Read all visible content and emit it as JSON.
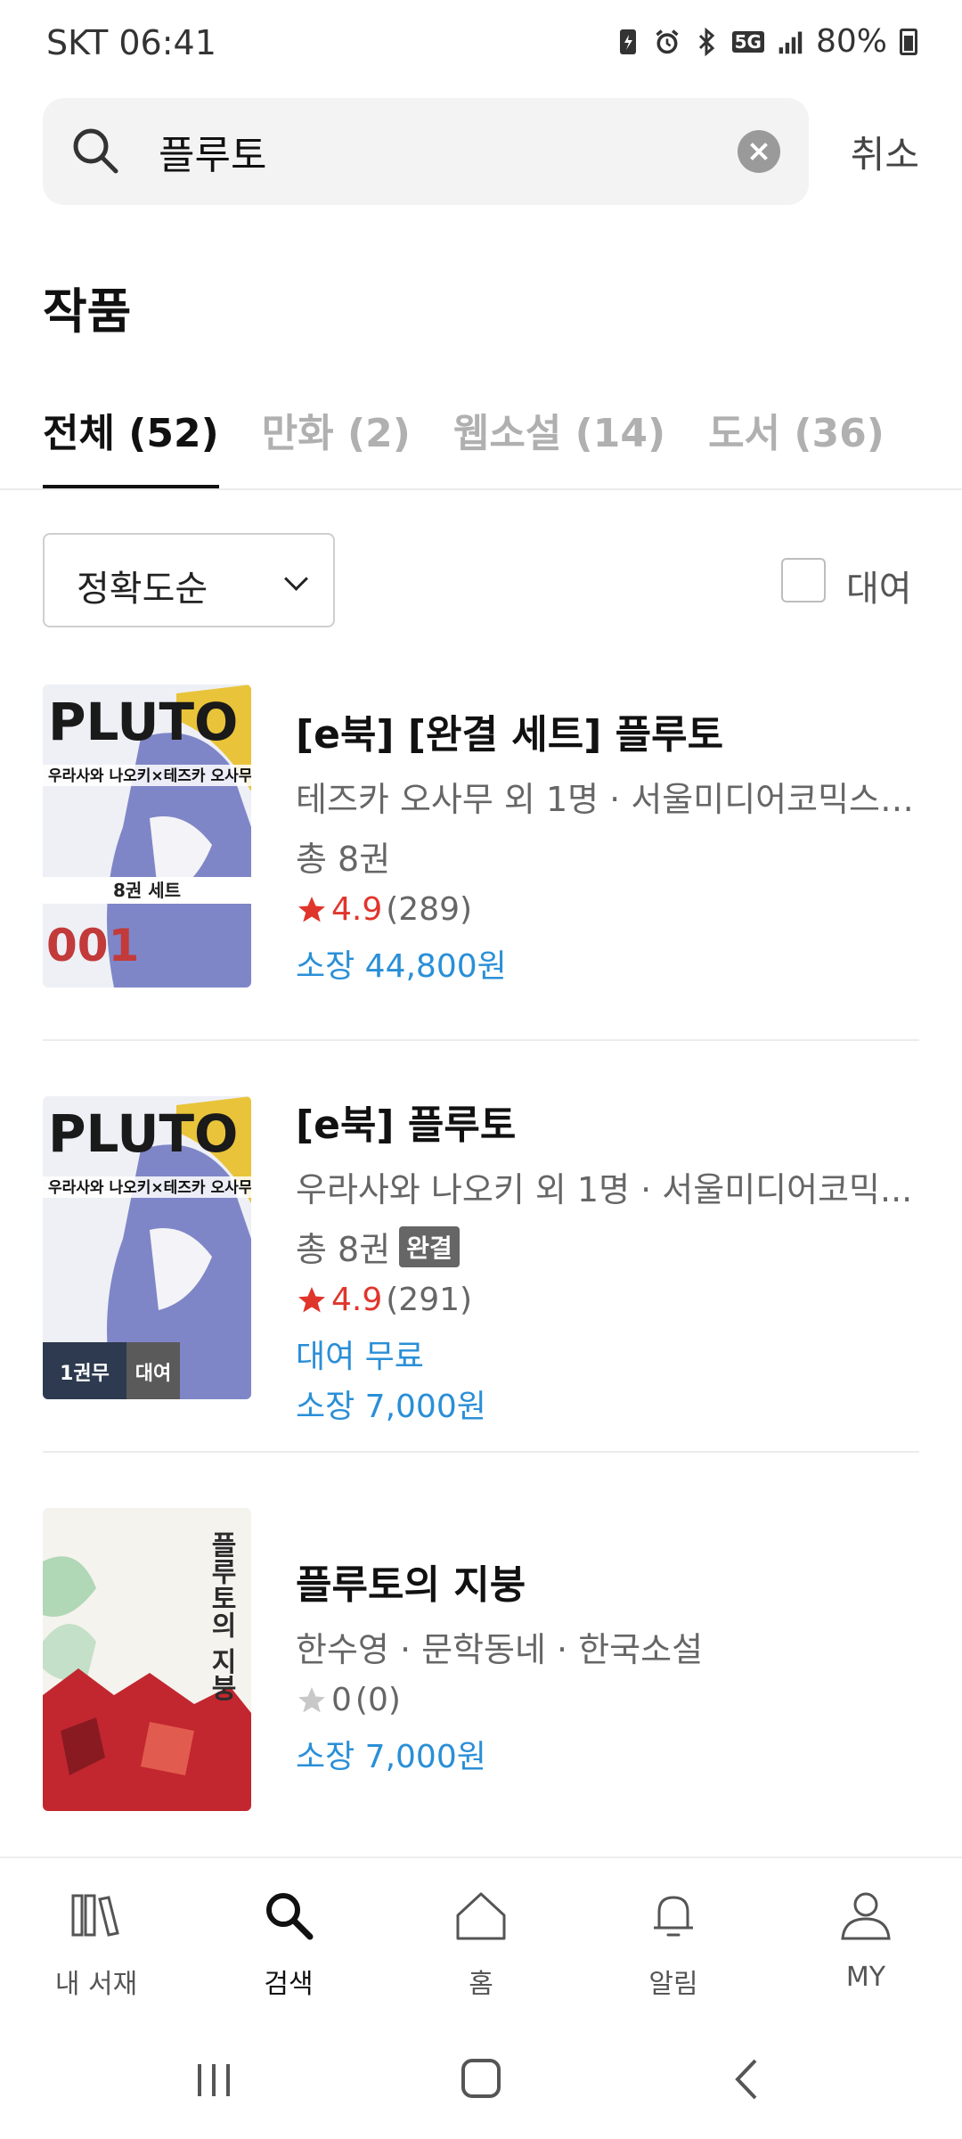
{
  "status_bar": {
    "carrier_time": "SKT 06:41",
    "battery": "80%",
    "network": "5G"
  },
  "search": {
    "query": "플루토",
    "cancel_label": "취소"
  },
  "section": {
    "title": "작품"
  },
  "tabs": [
    {
      "label": "전체 (52)",
      "active": true
    },
    {
      "label": "만화 (2)",
      "active": false
    },
    {
      "label": "웹소설 (14)",
      "active": false
    },
    {
      "label": "도서 (36)",
      "active": false
    }
  ],
  "filter": {
    "sort_label": "정확도순",
    "rent_label": "대여"
  },
  "items": [
    {
      "title": "[e북] [완결 세트] 플루토",
      "meta": "테즈카 오사무 외 1명 · 서울미디어코믹스/...",
      "count": "총 8권",
      "rating": "4.9",
      "rating_count": "(289)",
      "price": "소장 44,800원",
      "cover": {
        "header": "PLUTO",
        "subtitle": "우라사와 나오키×테즈카 오사무",
        "banner": "8권 세트",
        "number": "001"
      }
    },
    {
      "title": "[e북] 플루토",
      "meta": "우라사와 나오키 외 1명 · 서울미디어코믹...",
      "count": "총 8권",
      "badge": "완결",
      "rating": "4.9",
      "rating_count": "(291)",
      "rent_price": "대여 무료",
      "price": "소장 7,000원",
      "cover": {
        "header": "PLUTO",
        "subtitle": "우라사와 나오키×테즈카 오사무",
        "tag_left": "1권무",
        "tag_right": "대여"
      }
    },
    {
      "title": "플루토의 지붕",
      "meta": "한수영 · 문학동네 · 한국소설",
      "rating": "0",
      "rating_count": "(0)",
      "price": "소장 7,000원",
      "cover": {
        "vertical_title": "플루토의 지붕"
      }
    }
  ],
  "bottom_nav": [
    {
      "label": "내 서재",
      "icon": "library-icon"
    },
    {
      "label": "검색",
      "icon": "search-icon",
      "active": true
    },
    {
      "label": "홈",
      "icon": "home-icon"
    },
    {
      "label": "알림",
      "icon": "bell-icon"
    },
    {
      "label": "MY",
      "icon": "person-icon"
    }
  ],
  "colors": {
    "accent_blue": "#2a8fd7",
    "star_red": "#e0352b"
  }
}
